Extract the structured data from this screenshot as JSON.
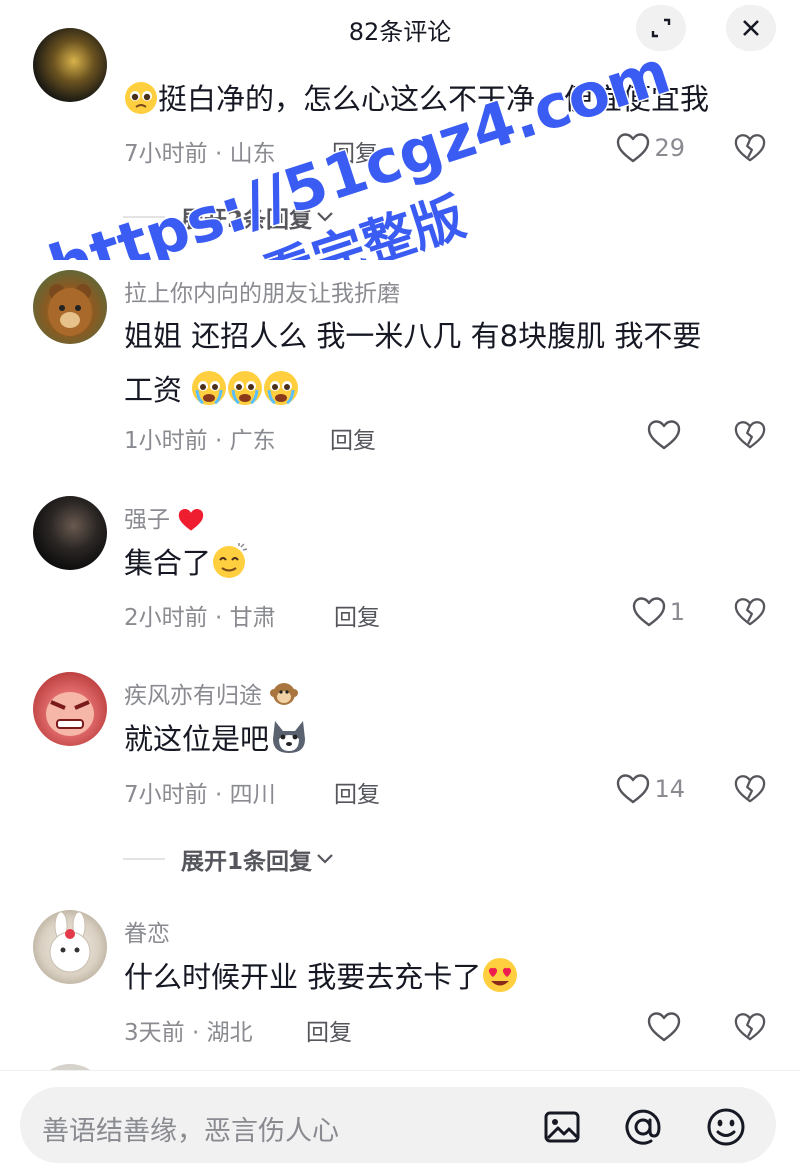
{
  "header": {
    "title": "82条评论"
  },
  "watermark": {
    "line1": "https://51cgz4.com",
    "line2": "看完整版",
    "color": "#3a5cf2"
  },
  "comments": [
    {
      "text": "挺白净的，怎么心这么不干净，便宜便宜我",
      "time_location": "7小时前 · 山东",
      "reply_label": "回复",
      "like_count": "29"
    },
    {
      "username": "拉上你内向的朋友让我折磨",
      "text_line1": "姐姐 还招人么 我一米八几  有8块腹肌 我不要",
      "text_line2": "工资",
      "time_location": "1小时前 · 广东",
      "reply_label": "回复",
      "like_count": ""
    },
    {
      "username": "强子",
      "text": "集合了",
      "time_location": "2小时前 · 甘肃",
      "reply_label": "回复",
      "like_count": "1"
    },
    {
      "username": "疾风亦有归途",
      "text": "就这位是吧",
      "time_location": "7小时前 · 四川",
      "reply_label": "回复",
      "like_count": "14"
    },
    {
      "username": "眷恋",
      "text": "什么时候开业 我要去充卡了",
      "time_location": "3天前 · 湖北",
      "reply_label": "回复",
      "like_count": ""
    }
  ],
  "expand_replies": [
    {
      "label": "展开2条回复"
    },
    {
      "label": "展开1条回复"
    }
  ],
  "input": {
    "placeholder": "善语结善缘，恶言伤人心"
  },
  "icons": {
    "expand": "expand-icon",
    "close": "close-icon",
    "like": "heart-outline-icon",
    "dislike": "broken-heart-icon",
    "chevron": "chevron-down-icon",
    "image": "image-icon",
    "mention": "at-icon",
    "emoji": "emoji-icon"
  }
}
